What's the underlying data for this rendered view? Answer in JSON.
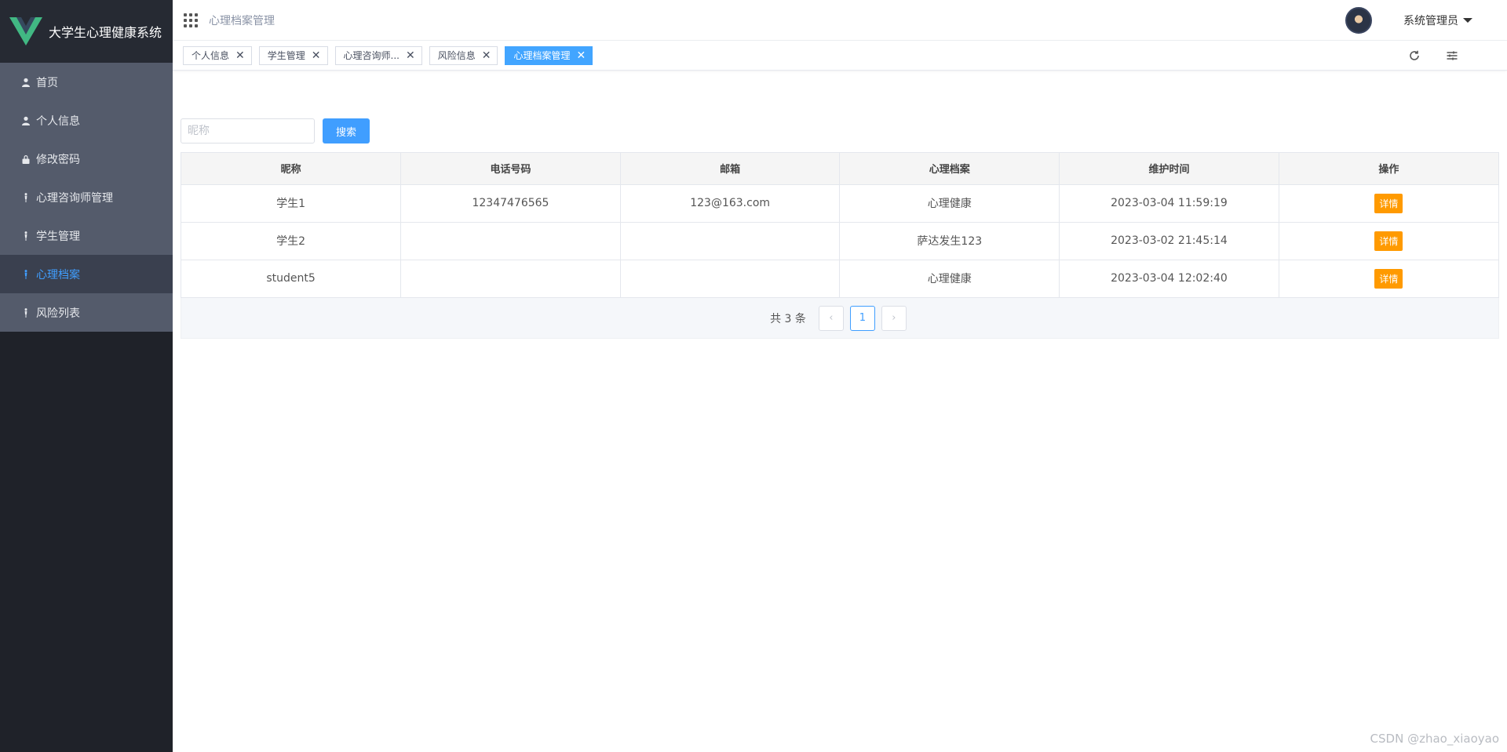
{
  "app": {
    "title": "大学生心理健康系统"
  },
  "sidebar": {
    "items": [
      {
        "label": "首页",
        "icon": "user-icon",
        "active": false
      },
      {
        "label": "个人信息",
        "icon": "user-icon",
        "active": false
      },
      {
        "label": "修改密码",
        "icon": "lock-icon",
        "active": false
      },
      {
        "label": "心理咨询师管理",
        "icon": "person-icon",
        "active": false
      },
      {
        "label": "学生管理",
        "icon": "person-icon",
        "active": false
      },
      {
        "label": "心理档案",
        "icon": "person-icon",
        "active": true
      },
      {
        "label": "风险列表",
        "icon": "person-icon",
        "active": false
      }
    ]
  },
  "header": {
    "breadcrumb": "心理档案管理",
    "user_name": "系统管理员"
  },
  "tags": [
    {
      "label": "个人信息",
      "active": false
    },
    {
      "label": "学生管理",
      "active": false
    },
    {
      "label": "心理咨询师...",
      "active": false
    },
    {
      "label": "风险信息",
      "active": false
    },
    {
      "label": "心理档案管理",
      "active": true
    }
  ],
  "search": {
    "placeholder": "昵称",
    "value": "",
    "button_label": "搜索"
  },
  "table": {
    "columns": [
      "昵称",
      "电话号码",
      "邮箱",
      "心理档案",
      "维护时间",
      "操作"
    ],
    "rows": [
      {
        "nickname": "学生1",
        "phone": "12347476565",
        "email": "123@163.com",
        "archive": "心理健康",
        "time": "2023-03-04 11:59:19",
        "action": "详情"
      },
      {
        "nickname": "学生2",
        "phone": "",
        "email": "",
        "archive": "萨达发生123",
        "time": "2023-03-02 21:45:14",
        "action": "详情"
      },
      {
        "nickname": "student5",
        "phone": "",
        "email": "",
        "archive": "心理健康",
        "time": "2023-03-04 12:02:40",
        "action": "详情"
      }
    ]
  },
  "pagination": {
    "total_text": "共 3 条",
    "prev": "‹",
    "current": "1",
    "next": "›"
  },
  "watermark": "CSDN @zhao_xiaoyao",
  "colors": {
    "accent": "#409eff",
    "sidebar_bg": "#1f2229",
    "menu_bg": "#545b6b",
    "detail_button": "#ff9a00"
  }
}
